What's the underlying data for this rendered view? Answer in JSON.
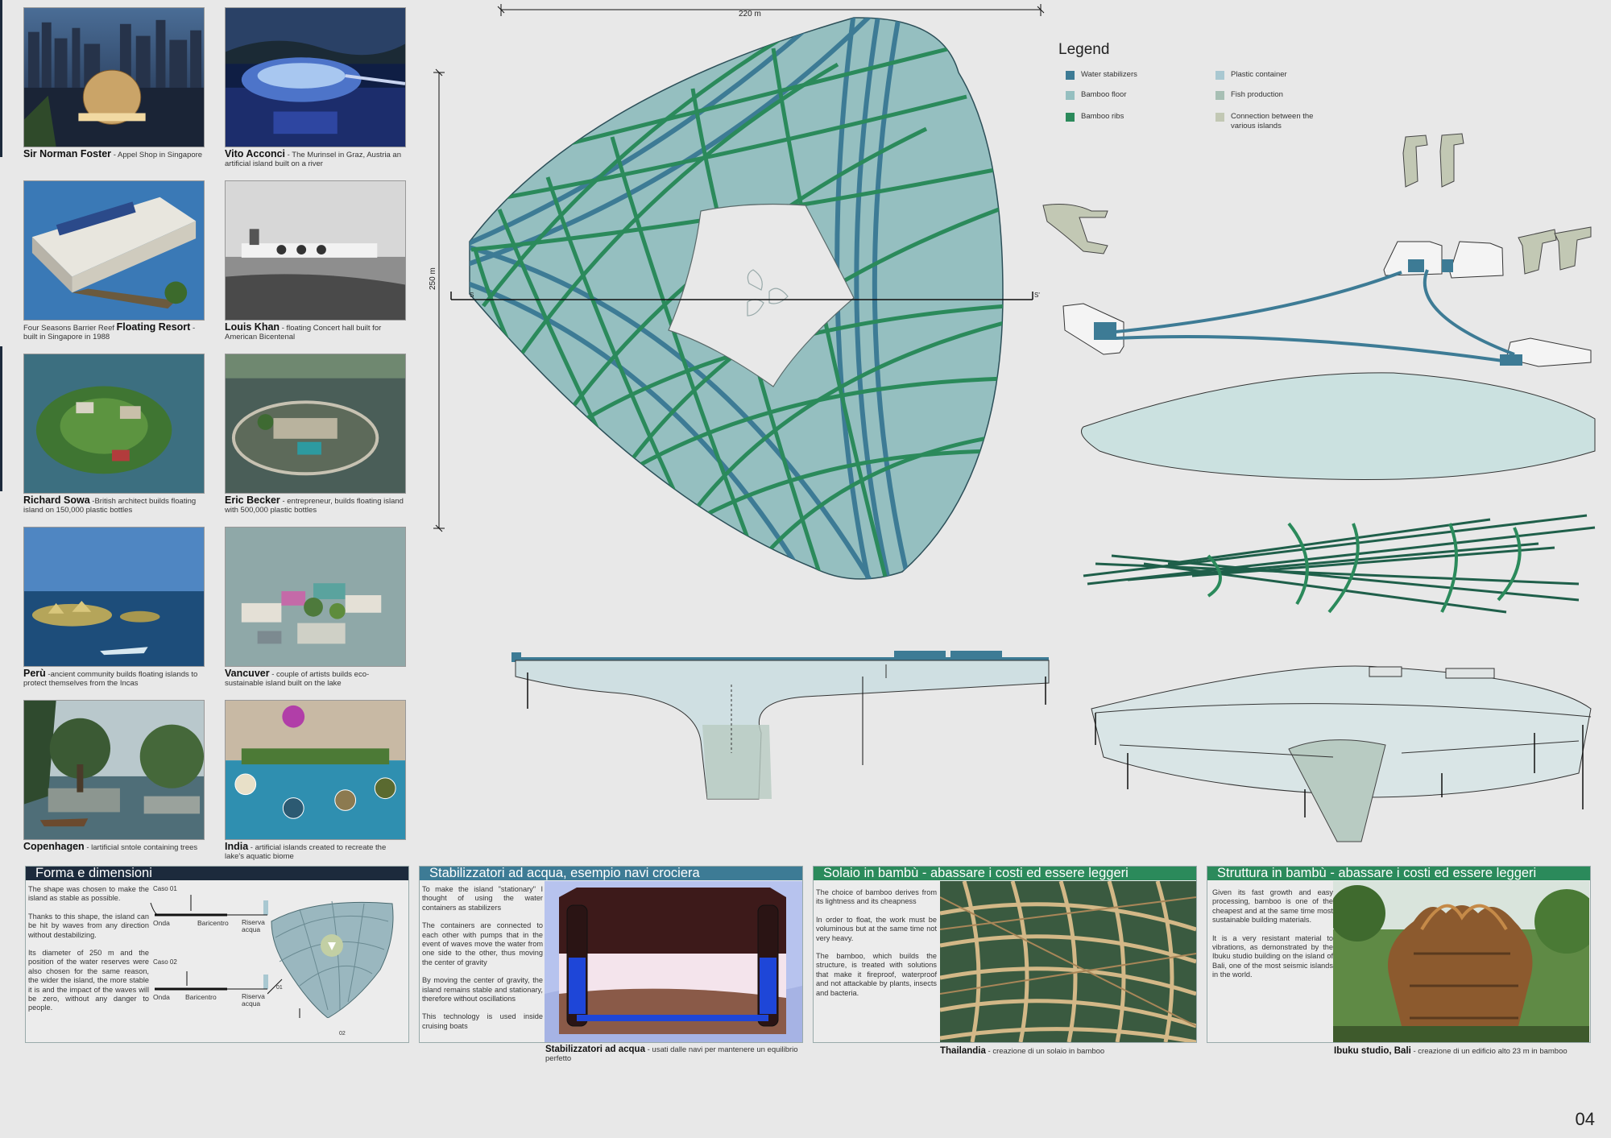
{
  "references": [
    {
      "name": "Sir Norman Foster",
      "desc": " - Appel Shop in Singapore"
    },
    {
      "name": "Vito Acconci",
      "desc": " - The Murinsel in Graz, Austria an artificial island built on a river"
    },
    {
      "pre": "Four Seasons Barrier Reef ",
      "name": "Floating Resort",
      "desc": " - built in Singapore in 1988"
    },
    {
      "name": "Louis Khan",
      "desc": " - floating Concert hall built for American Bicentenal"
    },
    {
      "name": "Richard Sowa",
      "desc": " -British architect builds floating island on 150,000 plastic bottles"
    },
    {
      "name": "Eric Becker",
      "desc": " - entrepreneur, builds floating island with 500,000 plastic bottles"
    },
    {
      "name": "Perù",
      "desc": " -ancient community builds floating islands to protect themselves from the Incas"
    },
    {
      "name": "Vancuver",
      "desc": " - couple of artists builds eco-sustainable island built on the lake"
    },
    {
      "name": "Copenhagen",
      "desc": " - lartificial sntole containing trees"
    },
    {
      "name": "India",
      "desc": " - artificial islands created to recreate the lake's aquatic biome"
    }
  ],
  "plan": {
    "width_label": "220 m",
    "height_label": "250 m",
    "section_left": "S",
    "section_right": "S'"
  },
  "legend": {
    "title": "Legend",
    "items": [
      {
        "label": "Water stabilizers",
        "color": "#3d7b95"
      },
      {
        "label": "Bamboo floor",
        "color": "#95bfc0"
      },
      {
        "label": "Bamboo ribs",
        "color": "#2b8a5b"
      },
      {
        "label": "Plastic container",
        "color": "#a9c8d1"
      },
      {
        "label": "Fish production",
        "color": "#a7bfb4"
      },
      {
        "label": "Connection between the various islands",
        "color": "#c2c8b4"
      }
    ]
  },
  "panels": {
    "forma": {
      "title": "Forma e dimensioni",
      "p1": "The shape was chosen to make the island as stable as possible.",
      "p2": "Thanks to this shape, the island can be hit by waves from any direction without destabilizing.",
      "p3": "Its diameter of 250 m and the position of the water reserves were also chosen for the same reason, the wider the island, the more stable it is and the impact of the waves will be zero, without any danger to people.",
      "caso1": "Caso 01",
      "caso2": "Caso 02",
      "onda": "Onda",
      "baricentro": "Baricentro",
      "riserva": "Riserva acqua",
      "m01": "01",
      "m02": "02"
    },
    "stab": {
      "title": "Stabilizzatori ad acqua, esempio navi crociera",
      "p1": "To make the island \"stationary\" I thought of using the water containers as stabilizers",
      "p2": "The containers are connected to each other with pumps that in the event of waves move the water from one side to the other, thus moving the center of gravity",
      "p3": "By moving the center of gravity, the island remains stable and stationary, therefore without oscillations",
      "p4": "This technology is used inside cruising boats",
      "cap_name": "Stabilizzatori ad acqua",
      "cap_desc": " - usati dalle navi per mantenere un equilibrio perfetto"
    },
    "solaio": {
      "title": "Solaio in bambù - abassare i costi ed essere leggeri",
      "p1": "The choice of bamboo derives from its lightness and its cheapness",
      "p2": "In order to float, the work must be voluminous but at the same time not very heavy.",
      "p3": "The bamboo, which builds the structure, is treated with solutions that make it fireproof, waterproof and not attackable by plants, insects and bacteria.",
      "cap_name": "Thailandia",
      "cap_desc": " - creazione di un solaio in bamboo"
    },
    "struttura": {
      "title": "Struttura in bambù - abassare i costi ed essere leggeri",
      "p1": "Given its fast growth and easy processing, bamboo is one of the cheapest and at the same time most sustainable building materials.",
      "p2": "It is a very resistant material to vibrations, as demonstrated by the Ibuku studio building on the island of Bali, one of the most seismic islands in the world.",
      "cap_name": "Ibuku studio, Bali",
      "cap_desc": " - creazione di un edificio alto 23 m in bamboo"
    }
  },
  "page_number": "04"
}
